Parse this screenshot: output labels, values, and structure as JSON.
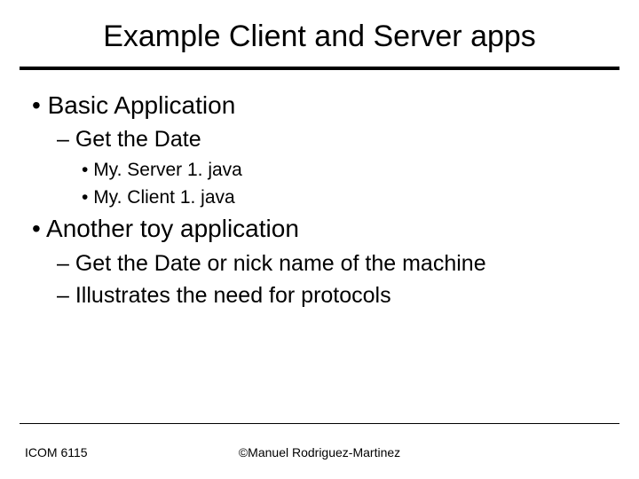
{
  "title": "Example Client and Server apps",
  "bullets": {
    "a": "Basic Application",
    "a1": "Get the Date",
    "a1i": "My. Server 1. java",
    "a1ii": "My. Client 1. java",
    "b": "Another toy application",
    "b1": "Get the Date or nick name of the machine",
    "b2": "Illustrates the need for protocols"
  },
  "footer": {
    "left": "ICOM 6115",
    "center": "©Manuel Rodriguez-Martinez"
  }
}
